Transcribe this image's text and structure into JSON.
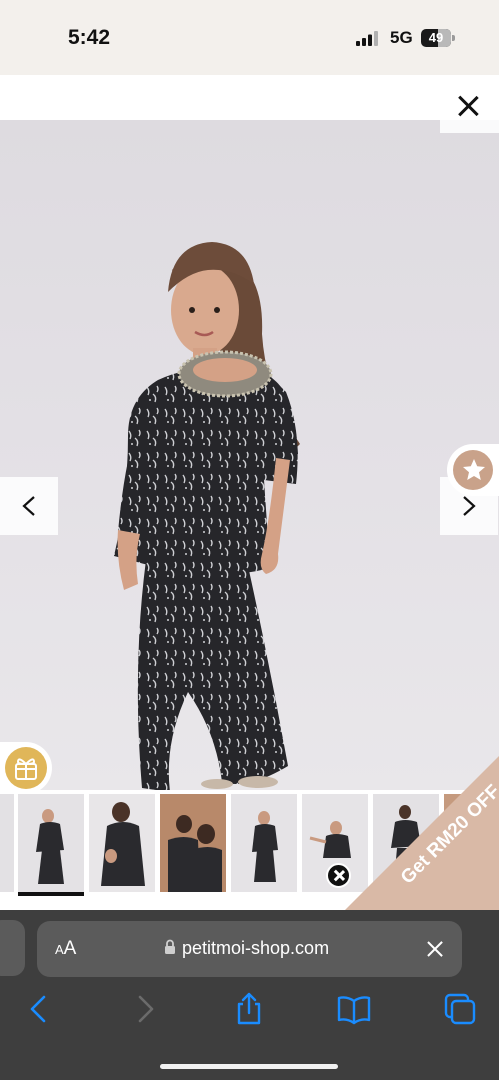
{
  "status_bar": {
    "time": "5:42",
    "network": "5G",
    "battery": "49"
  },
  "lightbox": {
    "close_icon": "close-icon",
    "prev_icon": "chevron-left-icon",
    "next_icon": "chevron-right-icon",
    "favorite_icon": "star-icon",
    "gift_icon": "gift-icon",
    "thumbnails": [
      {
        "name": "thumb-1",
        "active": false
      },
      {
        "name": "thumb-2",
        "active": true
      },
      {
        "name": "thumb-3",
        "active": false
      },
      {
        "name": "thumb-4",
        "active": false
      },
      {
        "name": "thumb-5",
        "active": false
      },
      {
        "name": "thumb-6",
        "active": false
      },
      {
        "name": "thumb-7",
        "active": false
      }
    ],
    "promo_text": "Get RM20 OFF"
  },
  "safari": {
    "aa_label": "AA",
    "url": "petitmoi-shop.com",
    "toolbar_icons": [
      "back-icon",
      "forward-icon",
      "share-icon",
      "bookmarks-icon",
      "tabs-icon"
    ]
  },
  "colors": {
    "status_bg": "#f3f0ec",
    "accent_blue": "#1a8cff",
    "promo": "#d9b9a6",
    "gift": "#e0b659",
    "favorite": "#c9a28a",
    "toolbar_bg": "#3e3e3e"
  }
}
